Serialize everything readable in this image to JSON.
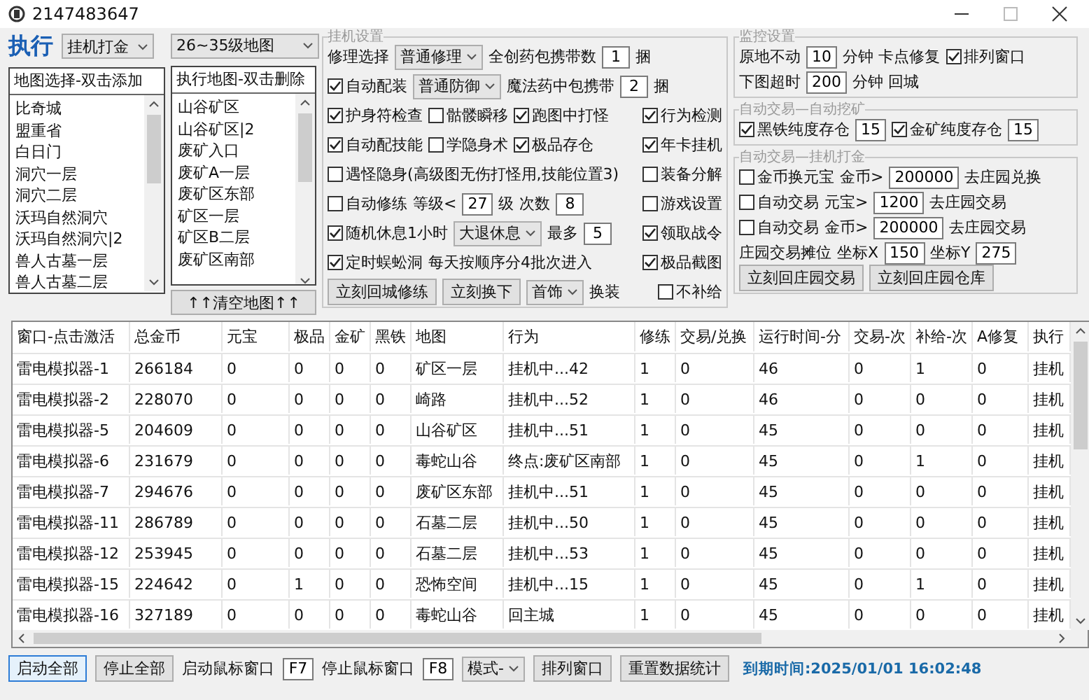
{
  "window": {
    "title": "2147483647"
  },
  "left": {
    "run_label": "执行",
    "mode_select": "挂机打金",
    "map_list": {
      "header": "地图选择-双击添加",
      "items": [
        "比奇城",
        "盟重省",
        "白日门",
        "洞穴一层",
        "洞穴二层",
        "沃玛自然洞穴",
        "沃玛自然洞穴|2",
        "兽人古墓一层",
        "兽人古墓二层"
      ]
    }
  },
  "middle": {
    "level_select": "26~35级地图",
    "map_list": {
      "header": "执行地图-双击删除",
      "items": [
        "山谷矿区",
        "山谷矿区|2",
        "废矿入口",
        "废矿A一层",
        "废矿区东部",
        "矿区一层",
        "矿区B二层",
        "废矿区南部"
      ]
    },
    "clear_button": "↑↑清空地图↑↑"
  },
  "groups": [
    {
      "title": "挂机设置",
      "rows": [
        {
          "items": [
            {
              "kind": "label",
              "text": "修理选择"
            },
            {
              "kind": "select",
              "value": "普通修理"
            },
            {
              "kind": "label",
              "text": "全创药包携带数"
            },
            {
              "kind": "input",
              "value": "1"
            },
            {
              "kind": "label",
              "text": "捆"
            }
          ]
        },
        {
          "items": [
            {
              "kind": "checkbox",
              "label": "自动配装",
              "checked": true
            },
            {
              "kind": "select",
              "value": "普通防御"
            },
            {
              "kind": "label",
              "text": "魔法药中包携带"
            },
            {
              "kind": "input",
              "value": "2"
            },
            {
              "kind": "label",
              "text": "捆"
            }
          ]
        },
        {
          "items": [
            {
              "kind": "checkbox",
              "label": "护身符检查",
              "checked": true
            },
            {
              "kind": "checkbox",
              "label": "骷髅瞬移",
              "checked": false
            },
            {
              "kind": "checkbox",
              "label": "跑图中打怪",
              "checked": true
            }
          ],
          "trailing": [
            {
              "kind": "checkbox",
              "label": "行为检测",
              "checked": true
            }
          ]
        },
        {
          "items": [
            {
              "kind": "checkbox",
              "label": "自动配技能",
              "checked": true
            },
            {
              "kind": "checkbox",
              "label": "学隐身术",
              "checked": false
            },
            {
              "kind": "checkbox",
              "label": "极品存仓",
              "checked": true
            }
          ],
          "trailing": [
            {
              "kind": "checkbox",
              "label": "年卡挂机",
              "checked": true
            }
          ]
        },
        {
          "items": [
            {
              "kind": "checkbox",
              "label": "遇怪隐身(高级图无伤打怪用,技能位置3)",
              "checked": false
            }
          ],
          "trailing": [
            {
              "kind": "checkbox",
              "label": "装备分解",
              "checked": false
            }
          ]
        },
        {
          "items": [
            {
              "kind": "checkbox",
              "label": "自动修练",
              "checked": false
            },
            {
              "kind": "label",
              "text": "等级<"
            },
            {
              "kind": "input",
              "value": "27"
            },
            {
              "kind": "label",
              "text": "级"
            },
            {
              "kind": "label",
              "text": "次数"
            },
            {
              "kind": "input",
              "value": "8"
            }
          ],
          "trailing": [
            {
              "kind": "checkbox",
              "label": "游戏设置",
              "checked": false
            }
          ]
        },
        {
          "items": [
            {
              "kind": "checkbox",
              "label": "随机休息1小时",
              "checked": true
            },
            {
              "kind": "select",
              "value": "大退休息"
            },
            {
              "kind": "label",
              "text": "最多"
            },
            {
              "kind": "input",
              "value": "5"
            }
          ],
          "trailing": [
            {
              "kind": "checkbox",
              "label": "领取战令",
              "checked": true
            }
          ]
        },
        {
          "items": [
            {
              "kind": "checkbox",
              "label": "定时蜈蚣洞",
              "checked": true
            },
            {
              "kind": "label",
              "text": "每天按顺序分4批次进入"
            }
          ],
          "trailing": [
            {
              "kind": "checkbox",
              "label": "极品截图",
              "checked": true
            }
          ]
        },
        {
          "items": [
            {
              "kind": "button",
              "label": "立刻回城修练"
            },
            {
              "kind": "button",
              "label": "立刻换下"
            },
            {
              "kind": "select",
              "value": "首饰"
            },
            {
              "kind": "label",
              "text": "换装"
            }
          ],
          "trailing": [
            {
              "kind": "checkbox",
              "label": "不补给",
              "checked": false
            }
          ]
        }
      ]
    },
    {
      "title": "监控设置",
      "rows": [
        {
          "items": [
            {
              "kind": "label",
              "text": "原地不动"
            },
            {
              "kind": "input",
              "value": "10"
            },
            {
              "kind": "label",
              "text": "分钟 卡点修复"
            },
            {
              "kind": "checkbox",
              "label": "排列窗口",
              "checked": true
            }
          ]
        },
        {
          "items": [
            {
              "kind": "label",
              "text": "下图超时"
            },
            {
              "kind": "input",
              "value": "200"
            },
            {
              "kind": "label",
              "text": "分钟 回城"
            }
          ]
        }
      ]
    },
    {
      "title": "自动交易—自动挖矿",
      "rows": [
        {
          "items": [
            {
              "kind": "checkbox",
              "label": "黑铁纯度存仓",
              "checked": true
            },
            {
              "kind": "input",
              "value": "15"
            },
            {
              "kind": "checkbox",
              "label": "金矿纯度存仓",
              "checked": true
            },
            {
              "kind": "input",
              "value": "15"
            }
          ]
        }
      ]
    },
    {
      "title": "自动交易—挂机打金",
      "rows": [
        {
          "items": [
            {
              "kind": "checkbox",
              "label": "金币换元宝",
              "checked": false
            },
            {
              "kind": "label",
              "text": "金币>"
            },
            {
              "kind": "input",
              "value": "200000"
            },
            {
              "kind": "label",
              "text": "去庄园兑换"
            }
          ]
        },
        {
          "items": [
            {
              "kind": "checkbox",
              "label": "自动交易",
              "checked": false
            },
            {
              "kind": "label",
              "text": "元宝>"
            },
            {
              "kind": "input",
              "value": "1200"
            },
            {
              "kind": "label",
              "text": "去庄园交易"
            }
          ]
        },
        {
          "items": [
            {
              "kind": "checkbox",
              "label": "自动交易",
              "checked": false
            },
            {
              "kind": "label",
              "text": "金币>"
            },
            {
              "kind": "input",
              "value": "200000"
            },
            {
              "kind": "label",
              "text": "去庄园交易"
            }
          ]
        },
        {
          "items": [
            {
              "kind": "label",
              "text": "庄园交易摊位"
            },
            {
              "kind": "label",
              "text": "坐标X"
            },
            {
              "kind": "input",
              "value": "150"
            },
            {
              "kind": "label",
              "text": "坐标Y"
            },
            {
              "kind": "input",
              "value": "275"
            }
          ]
        },
        {
          "items": [
            {
              "kind": "button",
              "label": "立刻回庄园交易"
            },
            {
              "kind": "button",
              "label": "立刻回庄园仓库"
            }
          ]
        }
      ]
    }
  ],
  "table": {
    "columns": [
      "窗口-点击激活",
      "总金币",
      "元宝",
      "极品",
      "金矿",
      "黑铁",
      "地图",
      "行为",
      "修练",
      "交易/兑换",
      "运行时间-分",
      "交易-次",
      "补给-次",
      "A修复",
      "执行"
    ],
    "rows": [
      [
        "雷电模拟器-1",
        "266184",
        "0",
        "0",
        "0",
        "0",
        "矿区一层",
        "挂机中...42",
        "1",
        "0",
        "46",
        "0",
        "1",
        "0",
        "挂机"
      ],
      [
        "雷电模拟器-2",
        "228070",
        "0",
        "0",
        "0",
        "0",
        "崎路",
        "挂机中...52",
        "1",
        "0",
        "46",
        "0",
        "0",
        "0",
        "挂机"
      ],
      [
        "雷电模拟器-5",
        "204609",
        "0",
        "0",
        "0",
        "0",
        "山谷矿区",
        "挂机中...51",
        "1",
        "0",
        "45",
        "0",
        "0",
        "0",
        "挂机"
      ],
      [
        "雷电模拟器-6",
        "231679",
        "0",
        "0",
        "0",
        "0",
        "毒蛇山谷",
        "终点:废矿区南部",
        "1",
        "0",
        "45",
        "0",
        "1",
        "0",
        "挂机"
      ],
      [
        "雷电模拟器-7",
        "294676",
        "0",
        "0",
        "0",
        "0",
        "废矿区东部",
        "挂机中...51",
        "1",
        "0",
        "45",
        "0",
        "0",
        "0",
        "挂机"
      ],
      [
        "雷电模拟器-11",
        "286789",
        "0",
        "0",
        "0",
        "0",
        "石墓二层",
        "挂机中...50",
        "1",
        "0",
        "45",
        "0",
        "0",
        "0",
        "挂机"
      ],
      [
        "雷电模拟器-12",
        "253945",
        "0",
        "0",
        "0",
        "0",
        "石墓二层",
        "挂机中...53",
        "1",
        "0",
        "45",
        "0",
        "0",
        "0",
        "挂机"
      ],
      [
        "雷电模拟器-15",
        "224642",
        "0",
        "1",
        "0",
        "0",
        "恐怖空间",
        "挂机中...15",
        "1",
        "0",
        "45",
        "0",
        "1",
        "0",
        "挂机"
      ],
      [
        "雷电模拟器-16",
        "327189",
        "0",
        "0",
        "0",
        "0",
        "毒蛇山谷",
        "回主城",
        "1",
        "0",
        "45",
        "0",
        "0",
        "0",
        "挂机"
      ]
    ]
  },
  "footer": {
    "items": [
      {
        "kind": "button",
        "label": "启动全部",
        "focused": true
      },
      {
        "kind": "button",
        "label": "停止全部",
        "focused": false
      },
      {
        "kind": "label",
        "text": "启动鼠标窗口"
      },
      {
        "kind": "input",
        "value": "F7"
      },
      {
        "kind": "label",
        "text": "停止鼠标窗口"
      },
      {
        "kind": "input",
        "value": "F8"
      },
      {
        "kind": "select",
        "value": "模式-"
      },
      {
        "kind": "button",
        "label": "排列窗口",
        "focused": false
      },
      {
        "kind": "button",
        "label": "重置数据统计",
        "focused": false
      }
    ],
    "expiry": "到期时间:2025/01/01 16:02:48"
  }
}
